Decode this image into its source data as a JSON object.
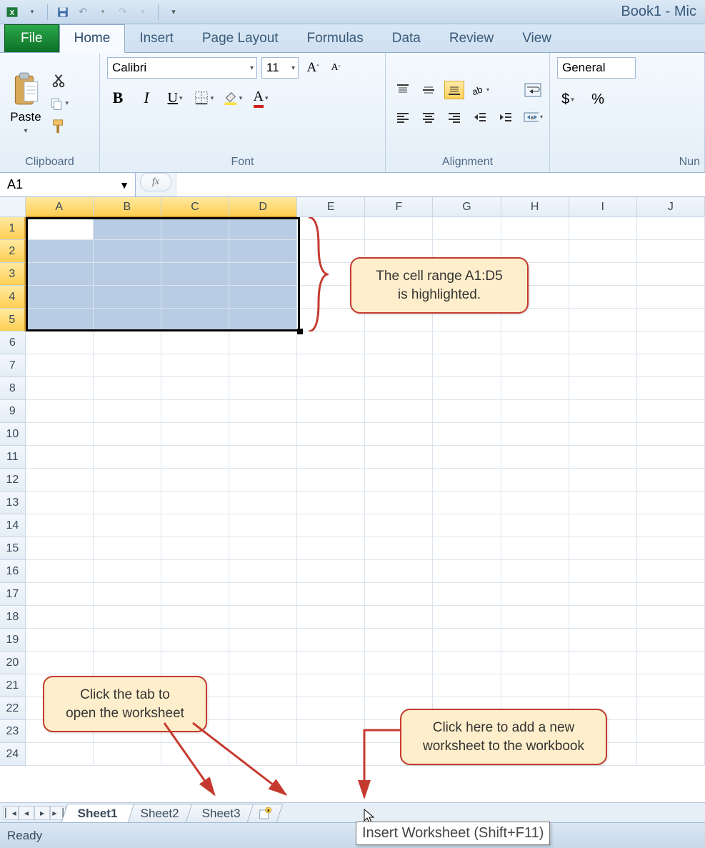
{
  "title": "Book1 - Mic",
  "tabs": {
    "file": "File",
    "items": [
      "Home",
      "Insert",
      "Page Layout",
      "Formulas",
      "Data",
      "Review",
      "View"
    ],
    "active": "Home"
  },
  "ribbon": {
    "clipboard": {
      "paste": "Paste",
      "label": "Clipboard"
    },
    "font": {
      "name": "Calibri",
      "size": "11",
      "label": "Font"
    },
    "alignment": {
      "label": "Alignment"
    },
    "number": {
      "format": "General",
      "currency": "$",
      "percent": "%",
      "label": "Nun"
    }
  },
  "namebox": "A1",
  "columns": [
    "A",
    "B",
    "C",
    "D",
    "E",
    "F",
    "G",
    "H",
    "I",
    "J"
  ],
  "selectedCols": [
    "A",
    "B",
    "C",
    "D"
  ],
  "rows": [
    1,
    2,
    3,
    4,
    5,
    6,
    7,
    8,
    9,
    10,
    11,
    12,
    13,
    14,
    15,
    16,
    17,
    18,
    19,
    20,
    21,
    22,
    23,
    24
  ],
  "selectedRows": [
    1,
    2,
    3,
    4,
    5
  ],
  "callouts": {
    "c1a": "The cell range A1:D5",
    "c1b": "is highlighted.",
    "c2a": "Click the tab to",
    "c2b": "open the worksheet",
    "c3a": "Click here to add a new",
    "c3b": "worksheet to the workbook"
  },
  "sheets": [
    "Sheet1",
    "Sheet2",
    "Sheet3"
  ],
  "activeSheet": "Sheet1",
  "status": "Ready",
  "tooltip": "Insert Worksheet (Shift+F11)"
}
